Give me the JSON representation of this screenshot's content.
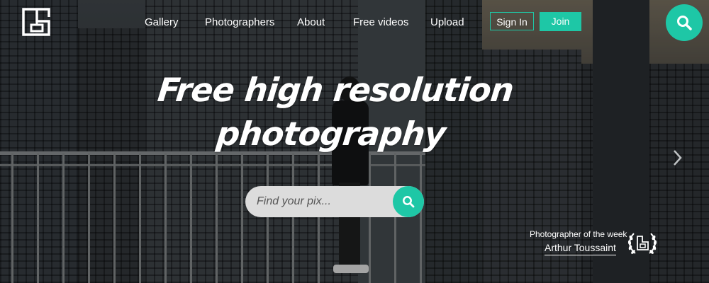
{
  "header": {
    "logo": "site-logo",
    "nav": [
      "Gallery",
      "Photographers",
      "About",
      "Free videos",
      "Upload"
    ],
    "sign_in": "Sign In",
    "join": "Join"
  },
  "hero": {
    "headline_line1": "Free high resolution",
    "headline_line2": "photography",
    "search_placeholder": "Find your pix..."
  },
  "photographer_of_week": {
    "caption": "Photographer of the week",
    "name": "Arthur Toussaint"
  },
  "colors": {
    "accent": "#1ec7a6"
  },
  "icons": [
    "search-icon",
    "chevron-right-icon",
    "laurel-badge-icon"
  ]
}
